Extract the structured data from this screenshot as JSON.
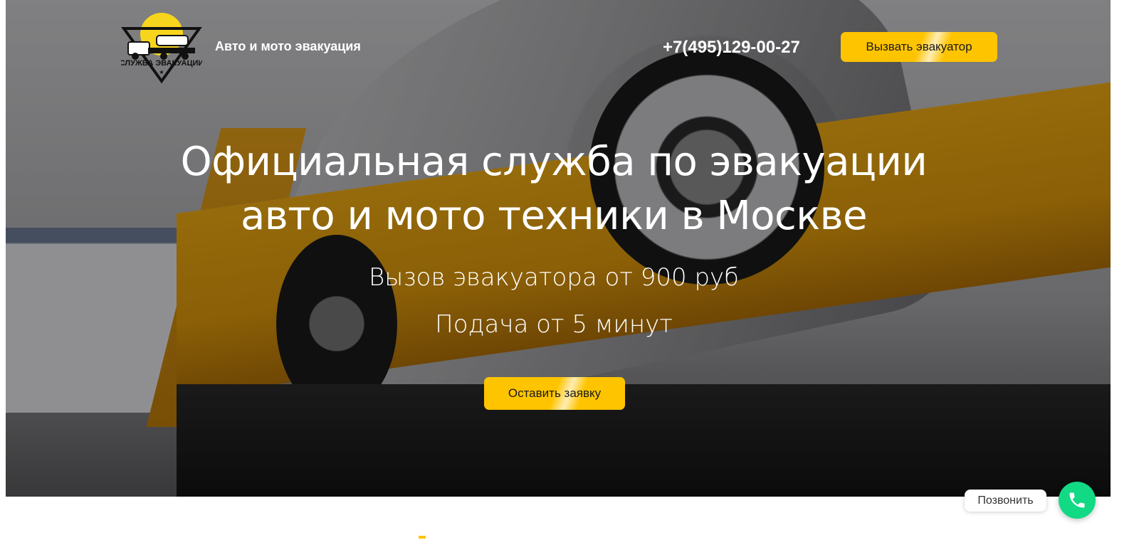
{
  "header": {
    "logo_text": "СЛУЖБА ЭВАКУАЦИИ",
    "tagline": "Авто и мото эвакуация",
    "phone": "+7(495)129-00-27",
    "call_button_label": "Вызвать эвакуатор"
  },
  "hero": {
    "headline_line1": "Официальная служба по эвакуации",
    "headline_line2": "авто и мото техники в Москве",
    "price_text": "Вызов эвакуатора от 900 руб",
    "time_text": "Подача от 5 минут",
    "cta_label": "Оставить заявку"
  },
  "callback_widget": {
    "label": "Позвонить",
    "icon": "phone-icon"
  },
  "colors": {
    "accent": "#ffc400",
    "call_green": "#12d984"
  }
}
